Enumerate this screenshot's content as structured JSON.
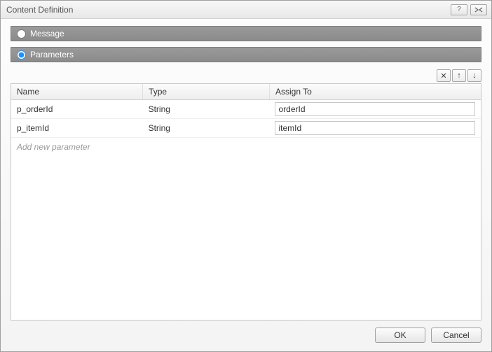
{
  "window": {
    "title": "Content Definition"
  },
  "options": {
    "message_label": "Message",
    "parameters_label": "Parameters",
    "selected": "parameters"
  },
  "toolbar": {
    "delete_icon": "✕",
    "up_icon": "↑",
    "down_icon": "↓"
  },
  "table": {
    "columns": {
      "name": "Name",
      "type": "Type",
      "assign_to": "Assign To"
    },
    "rows": [
      {
        "name": "p_orderId",
        "type": "String",
        "assign_to": "orderId"
      },
      {
        "name": "p_itemId",
        "type": "String",
        "assign_to": "itemId"
      }
    ],
    "add_placeholder": "Add new parameter"
  },
  "buttons": {
    "ok": "OK",
    "cancel": "Cancel"
  }
}
